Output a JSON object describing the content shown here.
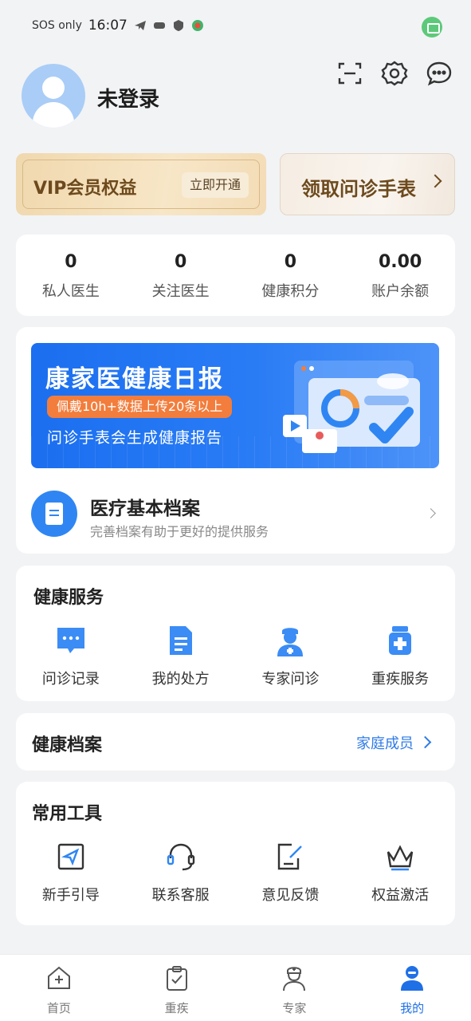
{
  "status_bar": {
    "carrier": "SOS only",
    "time": "16:07"
  },
  "profile": {
    "name": "未登录"
  },
  "header_icons": [
    "scan-icon",
    "settings-icon",
    "message-icon"
  ],
  "promo": {
    "vip_title": "VIP会员权益",
    "vip_button": "立即开通",
    "watch_title": "领取问诊手表"
  },
  "stats": [
    {
      "value": "0",
      "label": "私人医生"
    },
    {
      "value": "0",
      "label": "关注医生"
    },
    {
      "value": "0",
      "label": "健康积分"
    },
    {
      "value": "0.00",
      "label": "账户余额"
    }
  ],
  "banner": {
    "title": "康家医健康日报",
    "badge": "佩戴10h+数据上传20条以上",
    "subtitle": "问诊手表会生成健康报告"
  },
  "medical_record": {
    "title": "医疗基本档案",
    "subtitle": "完善档案有助于更好的提供服务"
  },
  "health_services": {
    "title": "健康服务",
    "items": [
      {
        "label": "问诊记录",
        "icon": "chat-bubble-icon"
      },
      {
        "label": "我的处方",
        "icon": "prescription-icon"
      },
      {
        "label": "专家问诊",
        "icon": "doctor-icon"
      },
      {
        "label": "重疾服务",
        "icon": "medicine-icon"
      }
    ]
  },
  "health_file": {
    "title": "健康档案",
    "link": "家庭成员"
  },
  "tools": {
    "title": "常用工具",
    "items": [
      {
        "label": "新手引导",
        "icon": "guide-icon"
      },
      {
        "label": "联系客服",
        "icon": "headset-icon"
      },
      {
        "label": "意见反馈",
        "icon": "feedback-icon"
      },
      {
        "label": "权益激活",
        "icon": "crown-icon"
      }
    ]
  },
  "tabs": [
    {
      "label": "首页",
      "icon": "home-icon",
      "active": false
    },
    {
      "label": "重疾",
      "icon": "clipboard-icon",
      "active": false
    },
    {
      "label": "专家",
      "icon": "nurse-icon",
      "active": false
    },
    {
      "label": "我的",
      "icon": "profile-icon",
      "active": true
    }
  ],
  "colors": {
    "accent": "#1f6fe6",
    "vip_gold": "#6d4a1d",
    "banner_blue": "#1b6ff0",
    "badge_orange": "#f27d3c"
  }
}
